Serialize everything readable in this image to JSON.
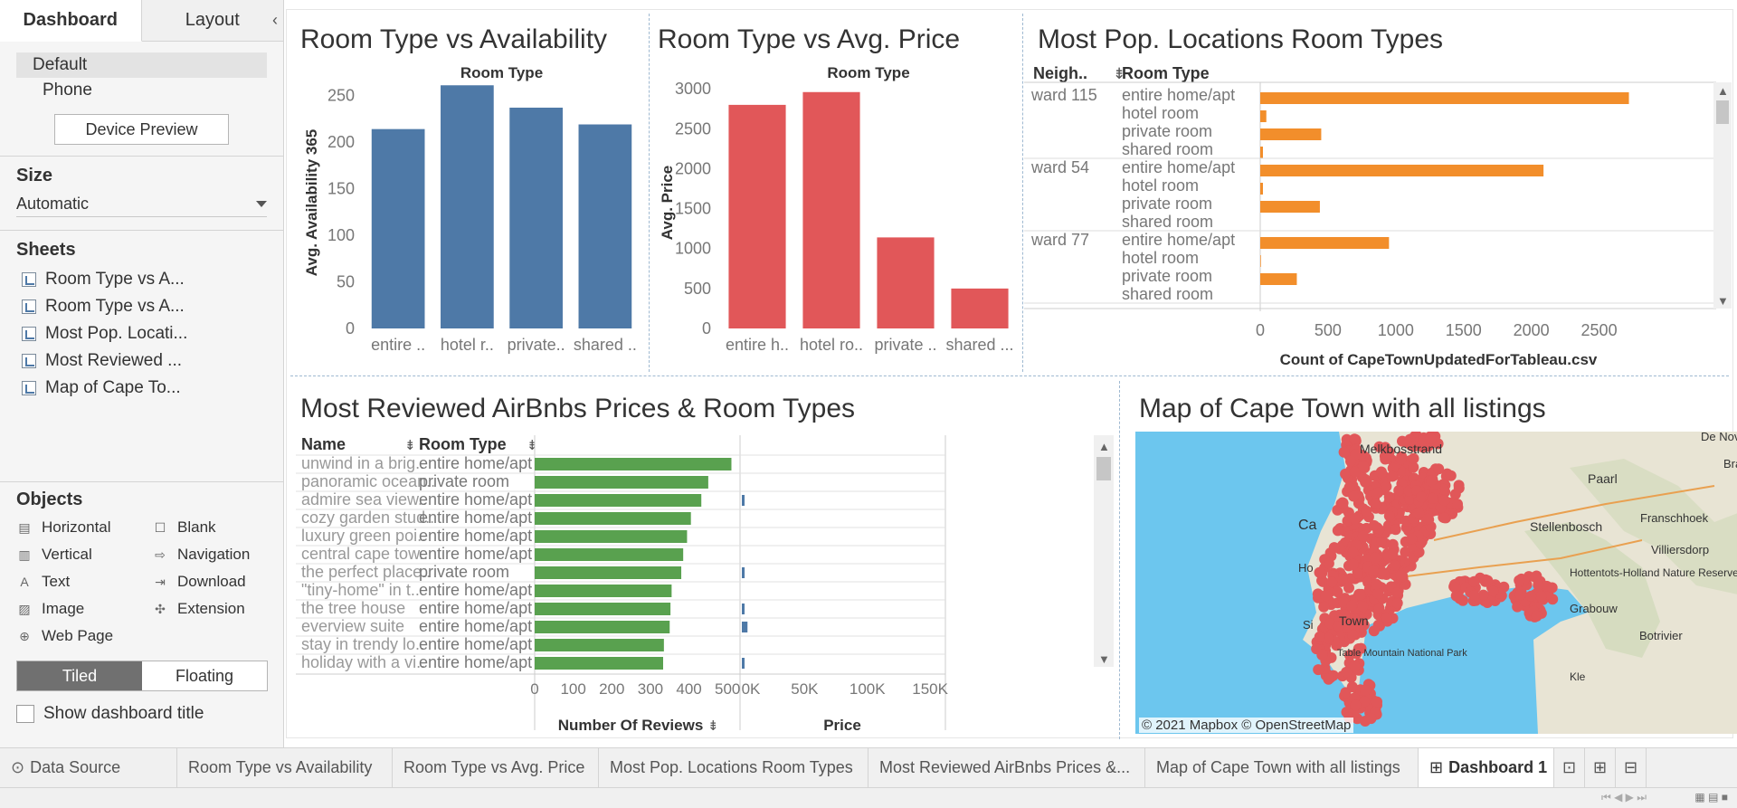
{
  "left_panel": {
    "tabs": [
      "Dashboard",
      "Layout"
    ],
    "collapse_glyph": "‹",
    "devices": [
      "Default",
      "Phone"
    ],
    "device_preview": "Device Preview",
    "size_label": "Size",
    "size_value": "Automatic",
    "sheets_label": "Sheets",
    "sheets": [
      "Room Type vs A...",
      "Room Type vs A...",
      "Most Pop. Locati...",
      "Most Reviewed ...",
      "Map of Cape To..."
    ],
    "objects_label": "Objects",
    "objects": [
      {
        "label": "Horizontal",
        "icon": "horizontal-icon"
      },
      {
        "label": "Blank",
        "icon": "blank-icon"
      },
      {
        "label": "Vertical",
        "icon": "vertical-icon"
      },
      {
        "label": "Navigation",
        "icon": "navigation-icon"
      },
      {
        "label": "Text",
        "icon": "text-icon"
      },
      {
        "label": "Download",
        "icon": "download-icon"
      },
      {
        "label": "Image",
        "icon": "image-icon"
      },
      {
        "label": "Extension",
        "icon": "extension-icon"
      },
      {
        "label": "Web Page",
        "icon": "web-page-icon"
      }
    ],
    "tiled": "Tiled",
    "floating": "Floating",
    "show_title": "Show dashboard title"
  },
  "charts": {
    "availability": {
      "title": "Room Type vs Availability",
      "header": "Room Type",
      "ylabel": "Avg. Availability 365"
    },
    "price": {
      "title": "Room Type vs Avg. Price",
      "header": "Room Type",
      "ylabel": "Avg. Price"
    },
    "locations": {
      "title": "Most Pop. Locations Room Types",
      "col1": "Neigh..",
      "col2": "Room Type",
      "xlabel": "Count of CapeTownUpdatedForTableau.csv"
    },
    "reviewed": {
      "title": "Most Reviewed AirBnbs Prices & Room Types",
      "col1": "Name",
      "col2": "Room Type",
      "xlabel1": "Number Of Reviews",
      "xlabel2": "Price"
    },
    "map": {
      "title": "Map of Cape Town with all listings",
      "credit": "© 2021 Mapbox © OpenStreetMap",
      "places": [
        "Melkbosstrand",
        "Paarl",
        "De Nova",
        "Bra",
        "Franschhoek",
        "Stellenbosch",
        "Villiersdorp",
        "Hottentots-Holland Nature Reserve",
        "Grabouw",
        "Botrivier",
        "Ca",
        "Ho",
        "Si",
        "Town",
        "Table Mountain National Park",
        "Kle"
      ]
    }
  },
  "chart_data": [
    {
      "type": "bar",
      "title": "Room Type vs Availability",
      "xlabel": "Room Type",
      "ylabel": "Avg. Availability 365",
      "categories": [
        "entire ..",
        "hotel r..",
        "private..",
        "shared .."
      ],
      "values": [
        214,
        261,
        237,
        219
      ],
      "ylim": [
        0,
        270
      ],
      "yticks": [
        0,
        50,
        100,
        150,
        200,
        250
      ],
      "color": "#4e79a7"
    },
    {
      "type": "bar",
      "title": "Room Type vs Avg. Price",
      "xlabel": "Room Type",
      "ylabel": "Avg. Price",
      "categories": [
        "entire h..",
        "hotel ro..",
        "private ..",
        "shared ..."
      ],
      "values": [
        2800,
        2960,
        1140,
        500
      ],
      "ylim": [
        0,
        3150
      ],
      "yticks": [
        0,
        500,
        1000,
        1500,
        2000,
        2500,
        3000
      ],
      "color": "#e15759"
    },
    {
      "type": "bar",
      "orientation": "horizontal",
      "title": "Most Pop. Locations Room Types",
      "xlabel": "Count of CapeTownUpdatedForTableau.csv",
      "xticks": [
        0,
        500,
        1000,
        1500,
        2000,
        2500
      ],
      "xlim": [
        0,
        2850
      ],
      "color": "#f28e2b",
      "groups": [
        {
          "neighbourhood": "ward 115",
          "rows": [
            {
              "room_type": "entire home/apt",
              "count": 2720
            },
            {
              "room_type": "hotel room",
              "count": 45
            },
            {
              "room_type": "private room",
              "count": 450
            },
            {
              "room_type": "shared room",
              "count": 20
            }
          ]
        },
        {
          "neighbourhood": "ward 54",
          "rows": [
            {
              "room_type": "entire home/apt",
              "count": 2090
            },
            {
              "room_type": "hotel room",
              "count": 20
            },
            {
              "room_type": "private room",
              "count": 440
            },
            {
              "room_type": "shared room",
              "count": 0
            }
          ]
        },
        {
          "neighbourhood": "ward 77",
          "rows": [
            {
              "room_type": "entire home/apt",
              "count": 950
            },
            {
              "room_type": "hotel room",
              "count": 5
            },
            {
              "room_type": "private room",
              "count": 270
            },
            {
              "room_type": "shared room",
              "count": 0
            }
          ]
        }
      ]
    },
    {
      "type": "bar",
      "orientation": "horizontal",
      "title": "Most Reviewed AirBnbs Prices & Room Types",
      "xlabel_reviews": "Number Of Reviews",
      "xlabel_price": "Price",
      "reviews_ticks": [
        0,
        100,
        200,
        300,
        400,
        500
      ],
      "reviews_xlim": [
        0,
        530
      ],
      "price_ticks": [
        "0K",
        "50K",
        "100K",
        "150K"
      ],
      "price_xlim": [
        0,
        160000
      ],
      "reviews_color": "#59a14f",
      "price_color": "#4e79a7",
      "rows": [
        {
          "name": "unwind in a brig..",
          "room_type": "entire home/apt",
          "reviews": 510,
          "price": 0
        },
        {
          "name": "panoramic ocean..",
          "room_type": "private room",
          "reviews": 450,
          "price": 0
        },
        {
          "name": "admire sea view..",
          "room_type": "entire home/apt",
          "reviews": 432,
          "price": 2000
        },
        {
          "name": "cozy garden stud..",
          "room_type": "entire home/apt",
          "reviews": 405,
          "price": 0
        },
        {
          "name": "luxury green poi..",
          "room_type": "entire home/apt",
          "reviews": 395,
          "price": 0
        },
        {
          "name": "central cape tow..",
          "room_type": "entire home/apt",
          "reviews": 385,
          "price": 0
        },
        {
          "name": "the perfect place..",
          "room_type": "private room",
          "reviews": 380,
          "price": 2200
        },
        {
          "name": "\"tiny-home\" in t..",
          "room_type": "entire home/apt",
          "reviews": 355,
          "price": 0
        },
        {
          "name": "the tree house",
          "room_type": "entire home/apt",
          "reviews": 352,
          "price": 1400
        },
        {
          "name": "everview suite",
          "room_type": "entire home/apt",
          "reviews": 350,
          "price": 4500
        },
        {
          "name": "stay in trendy lo..",
          "room_type": "entire home/apt",
          "reviews": 335,
          "price": 0
        },
        {
          "name": "holiday with a vi..",
          "room_type": "entire home/apt",
          "reviews": 333,
          "price": 600
        }
      ]
    }
  ],
  "bottom_tabs": [
    {
      "label": "Data Source",
      "icon": "data-source-icon"
    },
    {
      "label": "Room Type vs Availability"
    },
    {
      "label": "Room Type vs Avg. Price"
    },
    {
      "label": "Most Pop. Locations Room Types"
    },
    {
      "label": "Most Reviewed AirBnbs Prices &..."
    },
    {
      "label": "Map of Cape Town with all listings"
    },
    {
      "label": "Dashboard 1",
      "icon": "dashboard-icon",
      "active": true
    }
  ],
  "colors": {
    "availability": "#4e79a7",
    "price": "#e15759",
    "locations": "#f28e2b",
    "reviews": "#59a14f",
    "map_points": "#e15759",
    "water": "#6cc6ee",
    "land": "#e8e4d4"
  }
}
